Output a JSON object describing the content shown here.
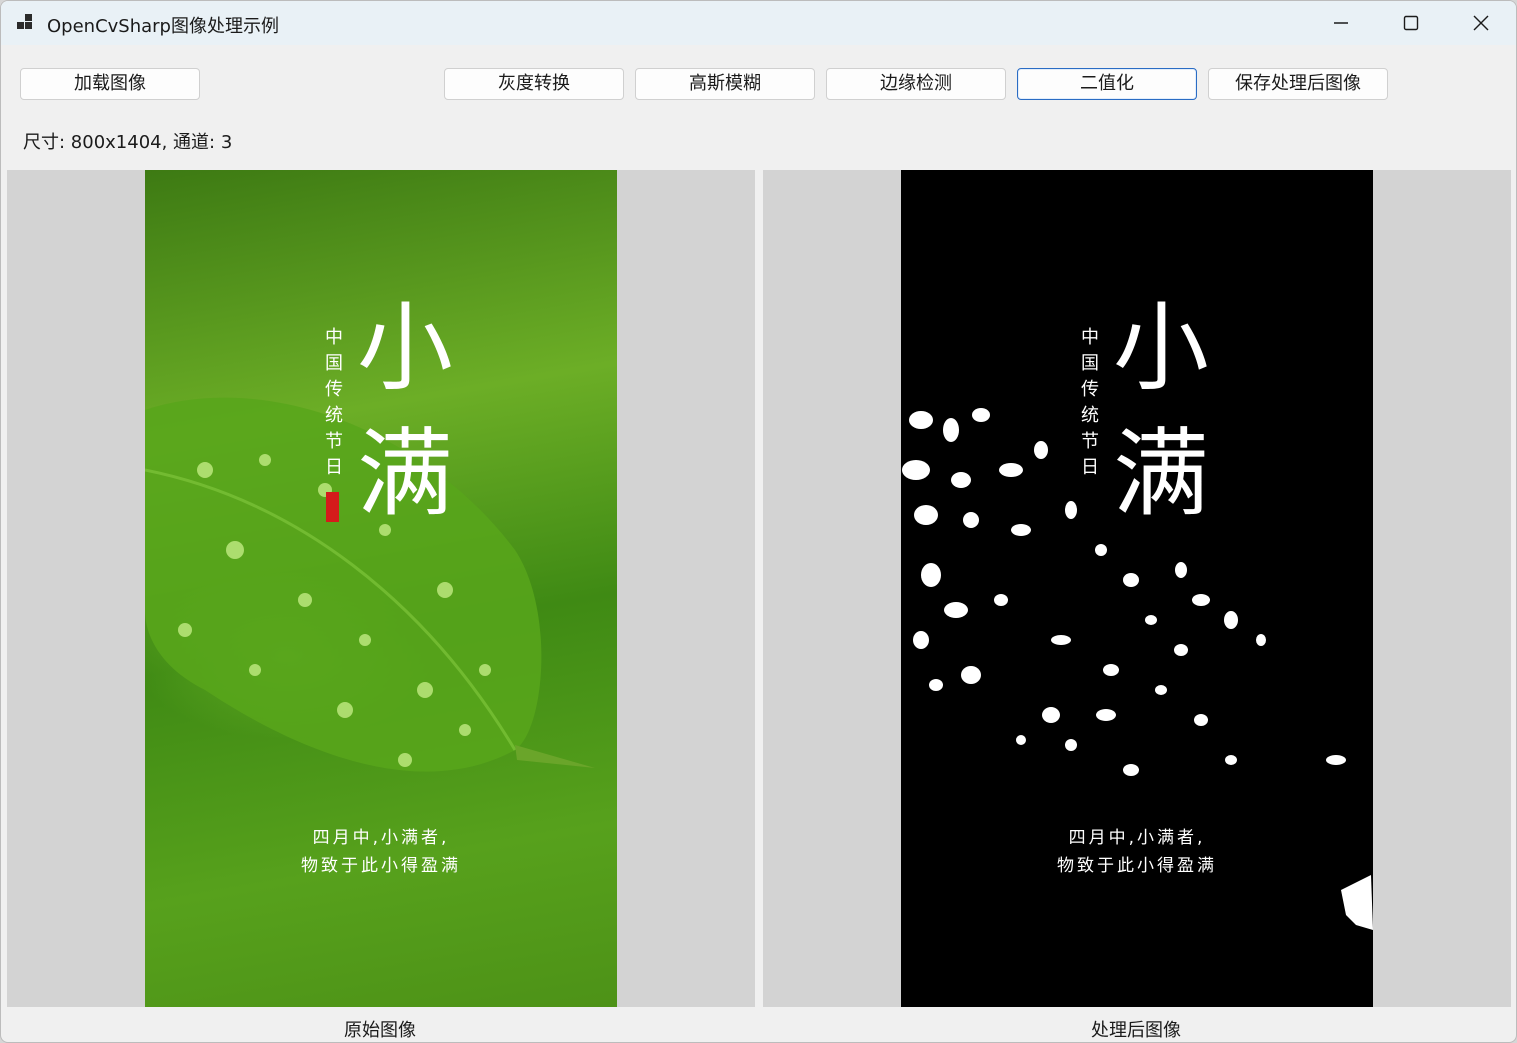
{
  "window": {
    "title": "OpenCvSharp图像处理示例"
  },
  "toolbar": {
    "load_label": "加载图像",
    "gray_label": "灰度转换",
    "blur_label": "高斯模糊",
    "edge_label": "边缘检测",
    "binary_label": "二值化",
    "save_label": "保存处理后图像"
  },
  "info": {
    "text": "尺寸: 800x1404, 通道: 3"
  },
  "poster": {
    "big_char_1": "小",
    "big_char_2": "满",
    "vertical_text": "中国传统节日",
    "line_1": "四月中,小满者,",
    "line_2": "物致于此小得盈满"
  },
  "captions": {
    "original": "原始图像",
    "processed": "处理后图像"
  },
  "colors": {
    "focus_border": "#2a6cc4",
    "leaf_green": "#5aa31e",
    "seal_red": "#d51b1b"
  },
  "icons": {
    "app": "app-icon",
    "minimize": "minimize-icon",
    "maximize": "maximize-icon",
    "close": "close-icon"
  }
}
